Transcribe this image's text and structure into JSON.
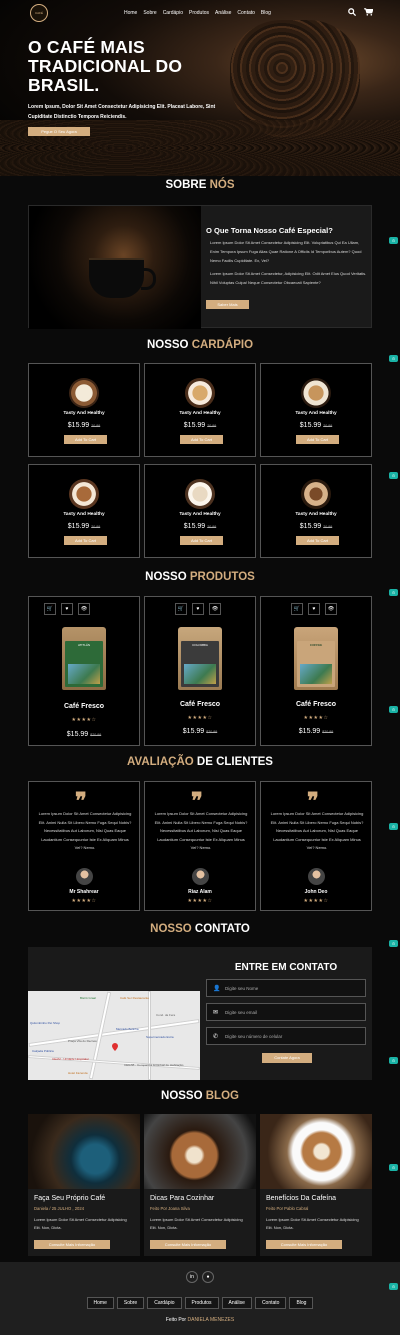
{
  "header": {
    "logo_text": "CAFÉ",
    "nav": [
      "Home",
      "Sobre",
      "Cardápio",
      "Produtos",
      "Análise",
      "Contato",
      "Blog"
    ],
    "icons": [
      "search-icon",
      "cart-icon"
    ]
  },
  "hero": {
    "title": "O CAFÉ MAIS TRADICIONAL DO BRASIL.",
    "subtitle": "Lorem Ipsum, Dolor Sit Amet Consectetur Adipisicing Elit. Placeat Labore, Sint Cupiditate Distinctio Tempora Reiciendis.",
    "cta": "Pegue O Seu Agora"
  },
  "about": {
    "title_a": "SOBRE ",
    "title_b": "NÓS",
    "heading": "O Que Torna Nosso Café Especial?",
    "p1": "Lorem Ipsum Dolor Sit Amet Consectetur Adipisicing Elit. Voluptatibus Qui Ea Ullam, Enim Tempora Ipsum Fuga Alias Quae Ratione A Officiis Id Temporibus Autem? Quod Nemo Facilis Cupiditate. Ex, Vel?",
    "p2": "Lorem Ipsum Dolor Sit Amet Consectetur, Adipisicing Elit. Odit Amet Eius Quod Veritatis. Nihil Voluptas Culpa! Neque Consectetur Obcaecati Sapiente?",
    "cta": "Saber Mais"
  },
  "menu": {
    "title_a": "NOSSO ",
    "title_b": "CARDÁPIO",
    "items": [
      {
        "name": "Tasty And Healthy",
        "price": "$15.99",
        "old": "20.99",
        "btn": "Add To Cart"
      },
      {
        "name": "Tasty And Healthy",
        "price": "$15.99",
        "old": "20.99",
        "btn": "Add To Cart"
      },
      {
        "name": "Tasty And Healthy",
        "price": "$15.99",
        "old": "20.99",
        "btn": "Add To Cart"
      },
      {
        "name": "Tasty And Healthy",
        "price": "$15.99",
        "old": "20.99",
        "btn": "Add To Cart"
      },
      {
        "name": "Tasty And Healthy",
        "price": "$15.99",
        "old": "20.99",
        "btn": "Add To Cart"
      },
      {
        "name": "Tasty And Healthy",
        "price": "$15.99",
        "old": "20.99",
        "btn": "Add To Cart"
      }
    ]
  },
  "products": {
    "title_a": "NOSSO ",
    "title_b": "PRODUTOS",
    "items": [
      {
        "name": "Café Fresco",
        "price": "$15.99",
        "old": "$20.99",
        "label": "ATITLÁN",
        "rating": 4.5
      },
      {
        "name": "Café Fresco",
        "price": "$15.99",
        "old": "$20.99",
        "label": "COLOMBIA",
        "rating": 4.5
      },
      {
        "name": "Café Fresco",
        "price": "$15.99",
        "old": "$20.99",
        "label": "COFFEE",
        "rating": 4.5
      }
    ]
  },
  "reviews": {
    "title_a": "AVALIAÇÃO",
    "title_b": " DE CLIENTES",
    "items": [
      {
        "text": "Lorem Ipsum Dolor Sit Amet Consectetur Adipisicing Elit. Animi Nulla Sit Libero Nemo Fuga Sequi Nobis? Necessitatibus Aut Laborum, Nisi Quas Eaque Laudantium Consequuntur Iste Ex Aliquam Minus Vel? Nemo.",
        "name": "Mr Shahrear",
        "rating": 4.5
      },
      {
        "text": "Lorem Ipsum Dolor Sit Amet Consectetur Adipisicing Elit. Animi Nulla Sit Libero Nemo Fuga Sequi Nobis? Necessitatibus Aut Laborum, Nisi Quas Eaque Laudantium Consequuntur Iste Ex Aliquam Minus Vel? Nemo.",
        "name": "Riaz Alam",
        "rating": 4.5
      },
      {
        "text": "Lorem Ipsum Dolor Sit Amet Consectetur Adipisicing Elit. Animi Nulla Sit Libero Nemo Fuga Sequi Nobis? Necessitatibus Aut Laborum, Nisi Quas Eaque Laudantium Consequuntur Iste Ex Aliquam Minus Vel? Nemo.",
        "name": "John Deo",
        "rating": 4.5
      }
    ]
  },
  "contact": {
    "title_a": "NOSSO",
    "title_b": " CONTATO",
    "heading": "ENTRE EM CONTATO",
    "name_ph": "Digite seu Nome",
    "email_ph": "Digite seu email",
    "phone_ph": "Digite seu número de celular",
    "submit": "Contate Agora",
    "map_labels": [
      "Bistrô Graal",
      "Café Ser Restaurante",
      "Cond. da Fera",
      "Quilombinho Pet Shop",
      "Mercado Bolinha",
      "Praça Vila do Recreio",
      "Supermercado Extra",
      "Calçada Pública",
      "CEAM - Unidade Hospitalar",
      "CEHAB - Companhia Estadual de Habitação",
      "Hotel Fazenda"
    ]
  },
  "blog": {
    "title_a": "NOSSO ",
    "title_b": "BLOG",
    "items": [
      {
        "title": "Faça Seu Próprio Café",
        "meta": "Daniela / 25 JULHO , 2024",
        "text": "Lorem Ipsum Dolor Sit Amet Consectetur Adipisicing Elit. Non, Dicta.",
        "btn": "Consulte Mais Informação"
      },
      {
        "title": "Dicas Para Cozinhar",
        "meta": "Feito Por Joana Silva",
        "text": "Lorem Ipsum Dolor Sit Amet Consectetur Adipisicing Elit. Non, Dicta.",
        "btn": "Consulte Mais Informação"
      },
      {
        "title": "Benefícios Da Cafeína",
        "meta": "Feito Por Pablo Cabral",
        "text": "Lorem Ipsum Dolor Sit Amet Consectetur Adipisicing Elit. Non, Dicta.",
        "btn": "Consulte Mais Informação"
      }
    ]
  },
  "footer": {
    "social": [
      "linkedin-icon",
      "github-icon"
    ],
    "links": [
      "Home",
      "Sobre",
      "Cardápio",
      "Produtos",
      "Análise",
      "Contato",
      "Blog"
    ],
    "credit_a": "Feito Por ",
    "credit_b": "DANIELA MENEZES"
  },
  "colors": {
    "accent": "#d3ad7f",
    "background": "#0a0a0a",
    "card": "#1a1a1a"
  }
}
